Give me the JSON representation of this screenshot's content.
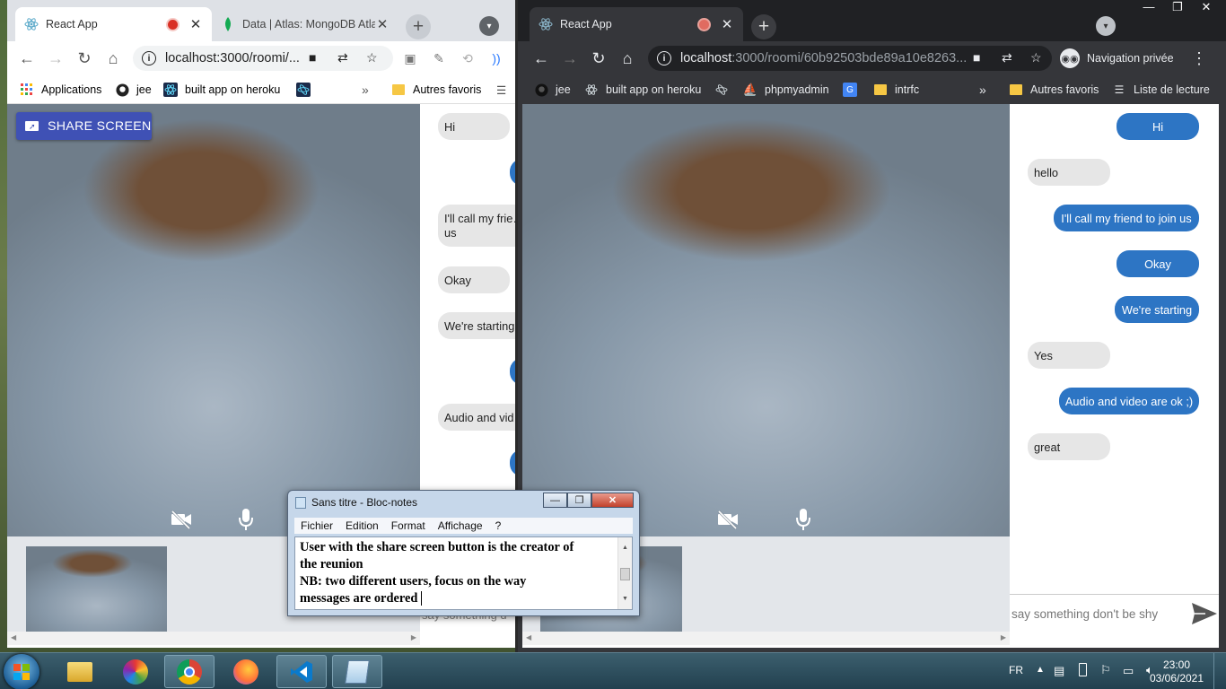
{
  "left_browser": {
    "tabs": [
      {
        "title": "React App",
        "recording": true
      },
      {
        "title": "Data | Atlas: MongoDB Atlas"
      }
    ],
    "url": "localhost:3000/roomi/...",
    "bookmarks": [
      "Applications",
      "jee",
      "built app on heroku"
    ],
    "page": {
      "share_button": "SHARE SCREEN",
      "messages": [
        {
          "text": "Hi",
          "side": "in"
        },
        {
          "text": "",
          "side": "out"
        },
        {
          "text": "I'll call my frie…",
          "text2": "us",
          "side": "in"
        },
        {
          "text": "Okay",
          "side": "in"
        },
        {
          "text": "We're starting",
          "side": "in"
        },
        {
          "text": "",
          "side": "out"
        },
        {
          "text": "Audio and vid",
          "side": "in"
        },
        {
          "text": "",
          "side": "out"
        }
      ],
      "input_placeholder": "say something d"
    }
  },
  "right_browser": {
    "tabs": [
      {
        "title": "React App",
        "recording": true
      }
    ],
    "url_host": "localhost",
    "url_rest": ":3000/roomi/60b92503bde89a10e8263...",
    "incognito_label": "Navigation privée",
    "bookmarks": [
      "jee",
      "built app on heroku",
      "phpmyadmin",
      "intrfc"
    ],
    "other_bookmarks": "Autres favoris",
    "reading_list": "Liste de lecture",
    "page": {
      "messages": [
        {
          "text": "Hi",
          "side": "out"
        },
        {
          "text": "hello",
          "side": "in"
        },
        {
          "text": "I'll call my friend to join us",
          "side": "out"
        },
        {
          "text": "Okay",
          "side": "out"
        },
        {
          "text": "We're starting",
          "side": "out"
        },
        {
          "text": "Yes",
          "side": "in"
        },
        {
          "text": "Audio and video are ok ;)",
          "side": "out"
        },
        {
          "text": "great",
          "side": "in"
        }
      ],
      "input_placeholder": "say something don't be shy"
    }
  },
  "left_other_bookmarks": "Autres favoris",
  "notepad": {
    "title": "Sans titre - Bloc-notes",
    "menu": [
      "Fichier",
      "Edition",
      "Format",
      "Affichage",
      "?"
    ],
    "lines": [
      "User with the share screen button is the creator of",
      "the reunion",
      "NB: two different users, focus on the way",
      "messages are ordered"
    ]
  },
  "taskbar": {
    "language": "FR",
    "time": "23:00",
    "date": "03/06/2021"
  }
}
